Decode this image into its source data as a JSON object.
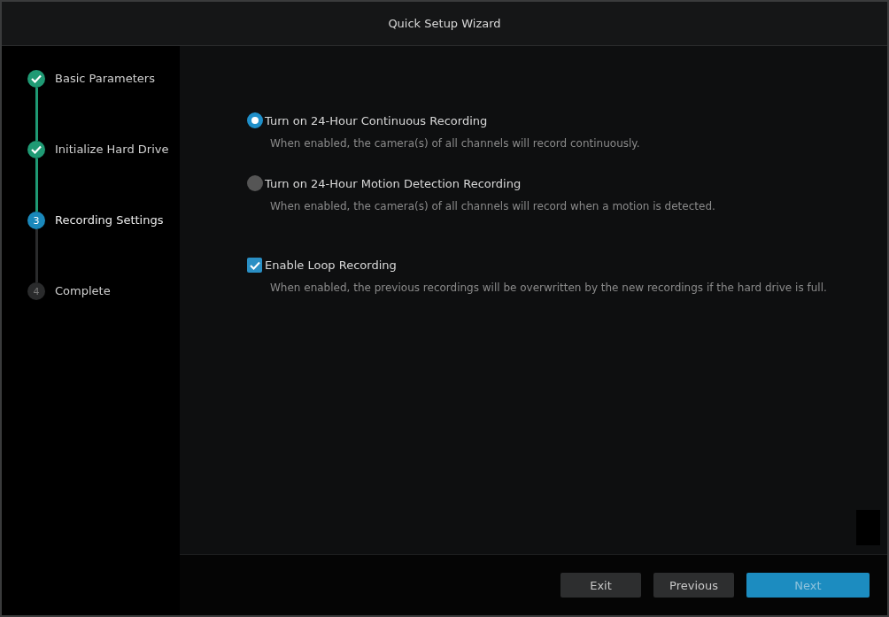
{
  "window": {
    "title": "Quick Setup Wizard"
  },
  "steps": [
    {
      "label": "Basic Parameters",
      "completed": true,
      "current": false
    },
    {
      "label": "Initialize Hard Drive",
      "completed": true,
      "current": false
    },
    {
      "label": "Recording Settings",
      "number": "3",
      "completed": false,
      "current": true
    },
    {
      "label": "Complete",
      "number": "4",
      "completed": false,
      "current": false
    }
  ],
  "options": [
    {
      "kind": "radio",
      "label": "Turn on 24-Hour Continuous Recording",
      "description": "When enabled, the camera(s) of all channels will record continuously.",
      "selected": true
    },
    {
      "kind": "radio",
      "label": "Turn on 24-Hour Motion Detection Recording",
      "description": "When enabled, the camera(s) of all channels will record when a motion is detected.",
      "selected": false
    },
    {
      "kind": "checkbox",
      "label": "Enable Loop Recording",
      "description": "When enabled, the previous recordings will be overwritten by the new recordings if the hard drive is full.",
      "checked": true
    }
  ],
  "buttons": [
    {
      "label": "Exit",
      "kind": "secondary"
    },
    {
      "label": "Previous",
      "kind": "secondary"
    },
    {
      "label": "Next",
      "kind": "primary"
    }
  ]
}
